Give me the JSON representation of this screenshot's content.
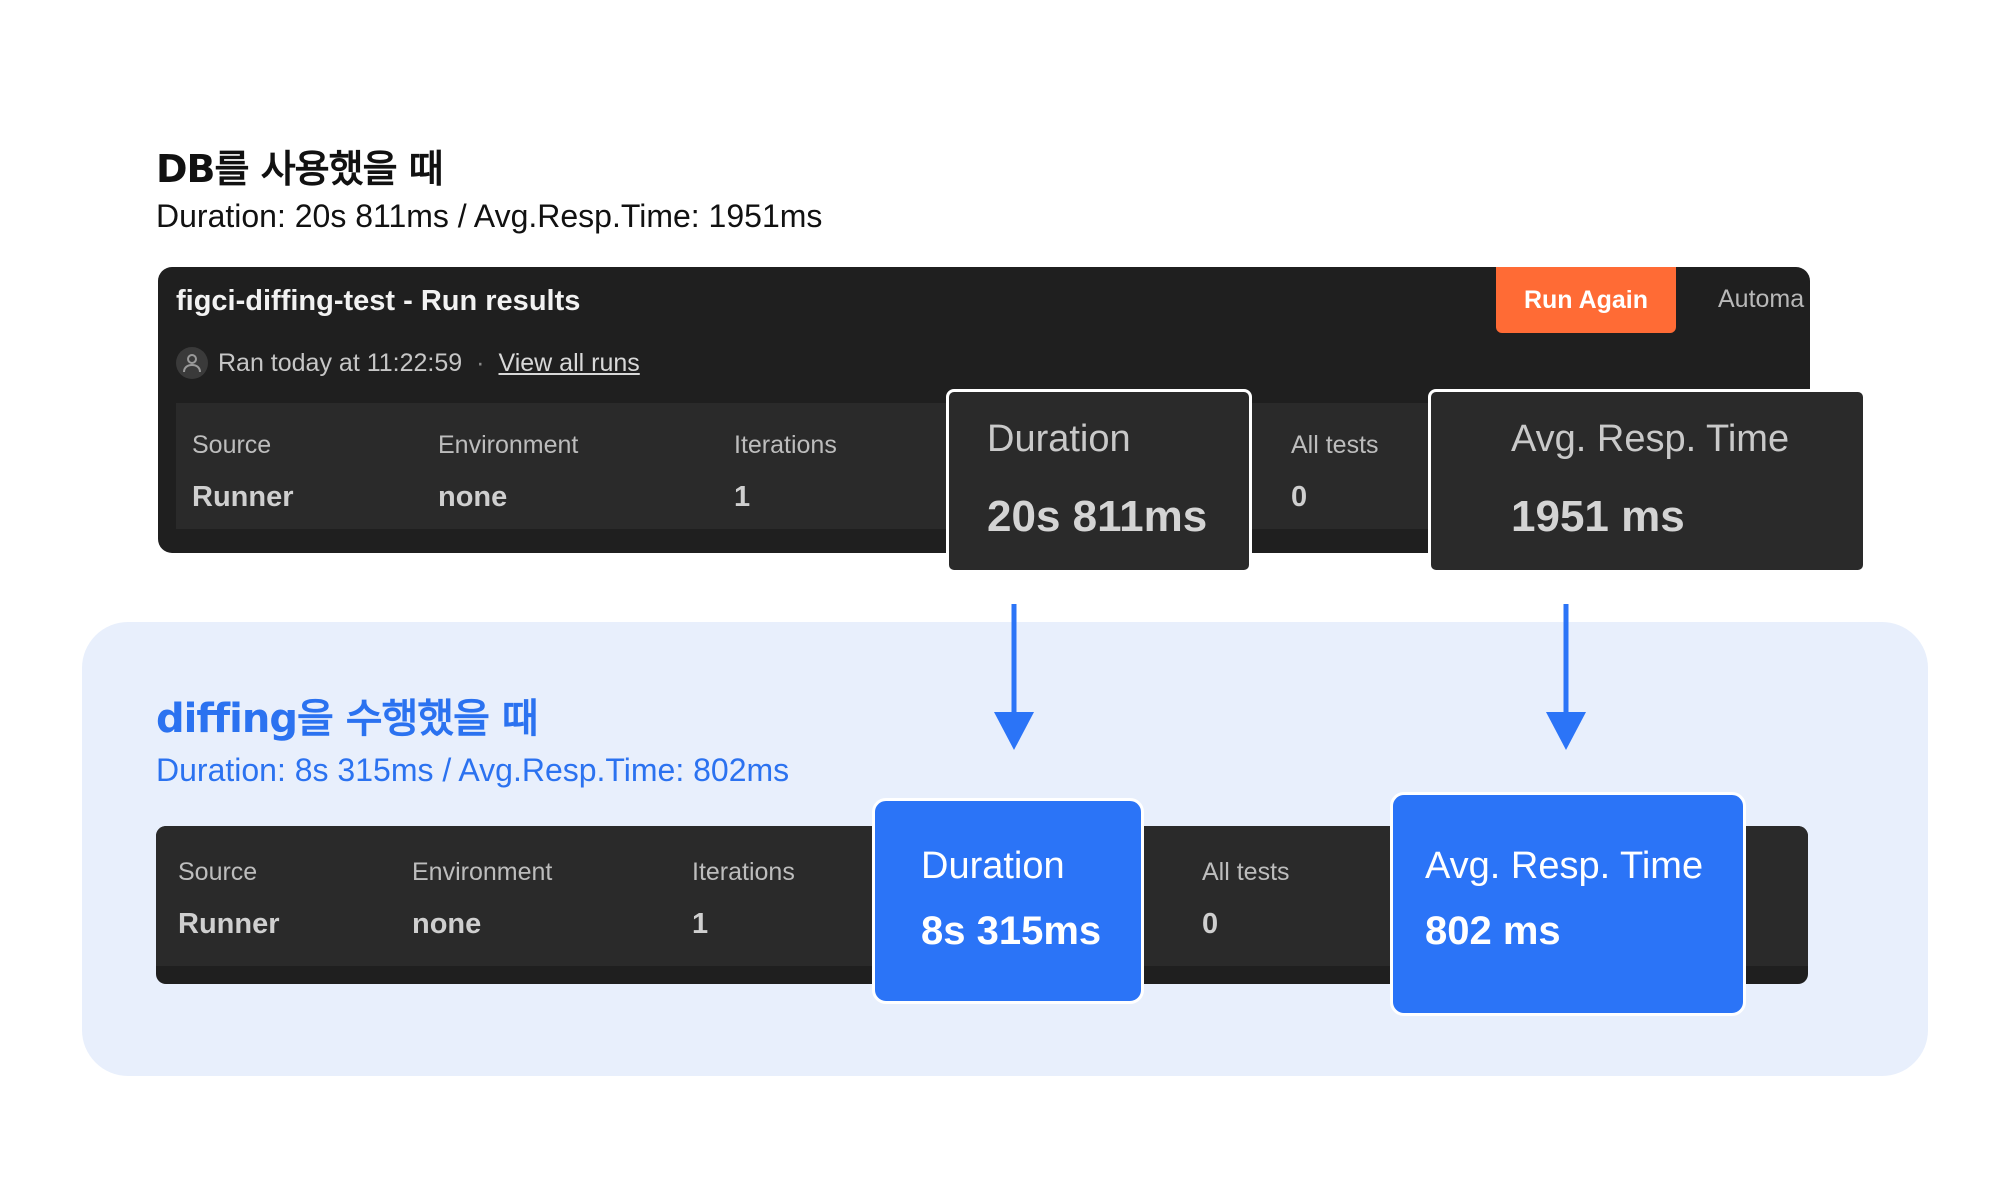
{
  "db_case": {
    "title": "DB를 사용했을 때",
    "subtitle": "Duration:  20s 811ms / Avg.Resp.Time: 1951ms"
  },
  "run_panel": {
    "title": "figci-diffing-test - Run results",
    "run_again_label": "Run Again",
    "automate_label": "Automa",
    "ran_text": "Ran today at 11:22:59",
    "separator": "·",
    "view_all_label": "View all runs",
    "stats": {
      "source_label": "Source",
      "source_value": "Runner",
      "environment_label": "Environment",
      "environment_value": "none",
      "iterations_label": "Iterations",
      "iterations_value": "1",
      "all_tests_label": "All tests",
      "all_tests_value": "0"
    },
    "duration_label": "Duration",
    "duration_value": "20s 811ms",
    "avg_label": "Avg. Resp. Time",
    "avg_value": "1951 ms"
  },
  "diffing_case": {
    "title": "diffing을 수행했을 때",
    "subtitle": "Duration:  8s 315ms / Avg.Resp.Time: 802ms",
    "stats": {
      "source_label": "Source",
      "source_value": "Runner",
      "environment_label": "Environment",
      "environment_value": "none",
      "iterations_label": "Iterations",
      "iterations_value": "1",
      "all_tests_label": "All tests",
      "all_tests_value": "0"
    },
    "duration_label": "Duration",
    "duration_value": "8s 315ms",
    "avg_label": "Avg. Resp. Time",
    "avg_value": "802 ms"
  },
  "colors": {
    "accent_blue": "#2b74f7",
    "run_again_orange": "#ff6b35",
    "panel_dark": "#1f1f1f",
    "highlight_bg": "#e8effc"
  }
}
